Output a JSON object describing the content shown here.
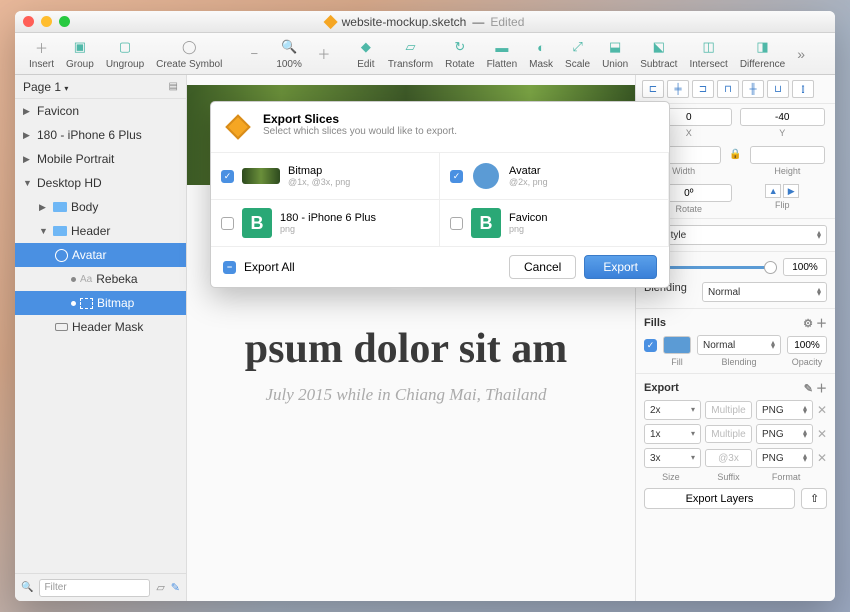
{
  "title": {
    "filename": "website-mockup.sketch",
    "status": "Edited"
  },
  "toolbar": [
    {
      "label": "Insert"
    },
    {
      "label": "Group"
    },
    {
      "label": "Ungroup"
    },
    {
      "label": "Create Symbol"
    },
    {
      "label": "100%"
    },
    {
      "label": "Edit"
    },
    {
      "label": "Transform"
    },
    {
      "label": "Rotate"
    },
    {
      "label": "Flatten"
    },
    {
      "label": "Mask"
    },
    {
      "label": "Scale"
    },
    {
      "label": "Union"
    },
    {
      "label": "Subtract"
    },
    {
      "label": "Intersect"
    },
    {
      "label": "Difference"
    }
  ],
  "sidebar": {
    "page": "Page 1",
    "items": [
      {
        "label": "Favicon",
        "depth": 0,
        "exp": false
      },
      {
        "label": "180 - iPhone 6 Plus",
        "depth": 0,
        "exp": false
      },
      {
        "label": "Mobile Portrait",
        "depth": 0,
        "exp": false
      },
      {
        "label": "Desktop HD",
        "depth": 0,
        "exp": true
      },
      {
        "label": "Body",
        "depth": 1,
        "exp": false,
        "folder": true
      },
      {
        "label": "Header",
        "depth": 1,
        "exp": true,
        "folder": true
      },
      {
        "label": "Avatar",
        "depth": 2,
        "sel": true,
        "circle": true
      },
      {
        "label": "Rebeka",
        "depth": 3,
        "text": true
      },
      {
        "label": "Bitmap",
        "depth": 3,
        "sel": true,
        "slice": true
      },
      {
        "label": "Header Mask",
        "depth": 2,
        "mask": true
      }
    ],
    "filter_placeholder": "Filter"
  },
  "canvas": {
    "heading": "psum dolor sit am",
    "sub": "July 2015 while in Chiang Mai, Thailand"
  },
  "inspector": {
    "x": "0",
    "y": "-40",
    "width": "",
    "height": "",
    "rotate": "0º",
    "x_lbl": "X",
    "y_lbl": "Y",
    "w_lbl": "Width",
    "h_lbl": "Height",
    "r_lbl": "Rotate",
    "f_lbl": "Flip",
    "sharedStyle": "ed Style",
    "opacity": "100%",
    "blending": "Normal",
    "blending_lbl": "Blending",
    "fills_hdr": "Fills",
    "fill_blend": "Normal",
    "fill_opacity": "100%",
    "fill_lbl": "Fill",
    "fb_lbl": "Blending",
    "fo_lbl": "Opacity",
    "export_hdr": "Export",
    "exports": [
      {
        "size": "2x",
        "suffix": "Multiple",
        "format": "PNG"
      },
      {
        "size": "1x",
        "suffix": "Multiple",
        "format": "PNG"
      },
      {
        "size": "3x",
        "suffix": "@3x",
        "format": "PNG"
      }
    ],
    "size_lbl": "Size",
    "suffix_lbl": "Suffix",
    "format_lbl": "Format",
    "export_btn": "Export Layers"
  },
  "dialog": {
    "title": "Export Slices",
    "sub": "Select which slices you would like to export.",
    "slices": [
      {
        "name": "Bitmap",
        "desc": "@1x, @3x, png",
        "checked": true,
        "thumb": "grass"
      },
      {
        "name": "Avatar",
        "desc": "@2x, png",
        "checked": true,
        "thumb": "circle"
      },
      {
        "name": "180 - iPhone 6 Plus",
        "desc": "png",
        "checked": false,
        "thumb": "B"
      },
      {
        "name": "Favicon",
        "desc": "png",
        "checked": false,
        "thumb": "B2"
      }
    ],
    "export_all": "Export All",
    "cancel": "Cancel",
    "export": "Export"
  }
}
